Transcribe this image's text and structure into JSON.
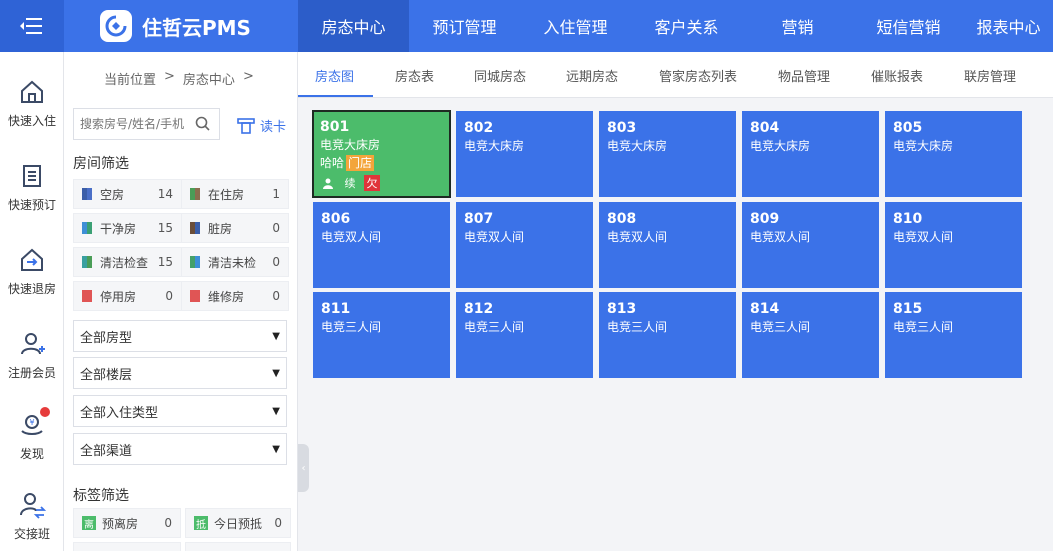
{
  "app": {
    "brand": "住哲云PMS"
  },
  "nav": {
    "items": [
      {
        "label": "房态中心",
        "active": true
      },
      {
        "label": "预订管理"
      },
      {
        "label": "入住管理"
      },
      {
        "label": "客户关系"
      },
      {
        "label": "营销"
      },
      {
        "label": "短信营销"
      },
      {
        "label": "报表中心"
      }
    ]
  },
  "rail": {
    "items": [
      {
        "label": "快速入住",
        "icon": "home-in-icon"
      },
      {
        "label": "快速预订",
        "icon": "clipboard-icon"
      },
      {
        "label": "快速退房",
        "icon": "home-out-icon"
      },
      {
        "label": "注册会员",
        "icon": "user-add-icon"
      },
      {
        "label": "发现",
        "icon": "discover-icon"
      },
      {
        "label": "交接班",
        "icon": "handover-icon"
      }
    ]
  },
  "breadcrumb": {
    "prefix": "当前位置",
    "sep1": ">",
    "current": "房态中心",
    "sep2": ">"
  },
  "search": {
    "placeholder": "搜索房号/姓名/手机"
  },
  "readcard": {
    "label": "读卡"
  },
  "filters": {
    "title": "房间筛选",
    "stats": [
      {
        "label": "空房",
        "count": "14",
        "color": "#3b5ea8"
      },
      {
        "label": "在住房",
        "count": "1",
        "color": "#4a9d57"
      },
      {
        "label": "干净房",
        "count": "15",
        "color": "#3e8fd6"
      },
      {
        "label": "脏房",
        "count": "0",
        "color": "#6b4e3a"
      },
      {
        "label": "清洁检查",
        "count": "15",
        "color": "#3aa0a0"
      },
      {
        "label": "清洁未检",
        "count": "0",
        "color": "#45a06a"
      },
      {
        "label": "停用房",
        "count": "0",
        "color": "#e05555"
      },
      {
        "label": "维修房",
        "count": "0",
        "color": "#e05555"
      }
    ],
    "selects": [
      {
        "label": "全部房型"
      },
      {
        "label": "全部楼层"
      },
      {
        "label": "全部入住类型"
      },
      {
        "label": "全部渠道"
      }
    ]
  },
  "tags": {
    "title": "标签筛选",
    "items": [
      {
        "icon_text": "离",
        "label": "预离房",
        "count": "0",
        "color": "#4cbc6b"
      },
      {
        "icon_text": "抵",
        "label": "今日预抵",
        "count": "0",
        "color": "#4cbc6b"
      }
    ]
  },
  "tabs": [
    {
      "label": "房态图",
      "active": true
    },
    {
      "label": "房态表"
    },
    {
      "label": "同城房态"
    },
    {
      "label": "远期房态"
    },
    {
      "label": "管家房态列表"
    },
    {
      "label": "物品管理"
    },
    {
      "label": "催账报表"
    },
    {
      "label": "联房管理"
    }
  ],
  "rooms": [
    {
      "num": "801",
      "type": "电竞大床房",
      "status": "occupied",
      "guest": "哈哈",
      "source": "门店",
      "flag1": "续",
      "flag2": "欠"
    },
    {
      "num": "802",
      "type": "电竞大床房"
    },
    {
      "num": "803",
      "type": "电竞大床房"
    },
    {
      "num": "804",
      "type": "电竞大床房"
    },
    {
      "num": "805",
      "type": "电竞大床房"
    },
    {
      "num": "806",
      "type": "电竞双人间"
    },
    {
      "num": "807",
      "type": "电竞双人间"
    },
    {
      "num": "808",
      "type": "电竞双人间"
    },
    {
      "num": "809",
      "type": "电竞双人间"
    },
    {
      "num": "810",
      "type": "电竞双人间"
    },
    {
      "num": "811",
      "type": "电竞三人间"
    },
    {
      "num": "812",
      "type": "电竞三人间"
    },
    {
      "num": "813",
      "type": "电竞三人间"
    },
    {
      "num": "814",
      "type": "电竞三人间"
    },
    {
      "num": "815",
      "type": "电竞三人间"
    }
  ]
}
